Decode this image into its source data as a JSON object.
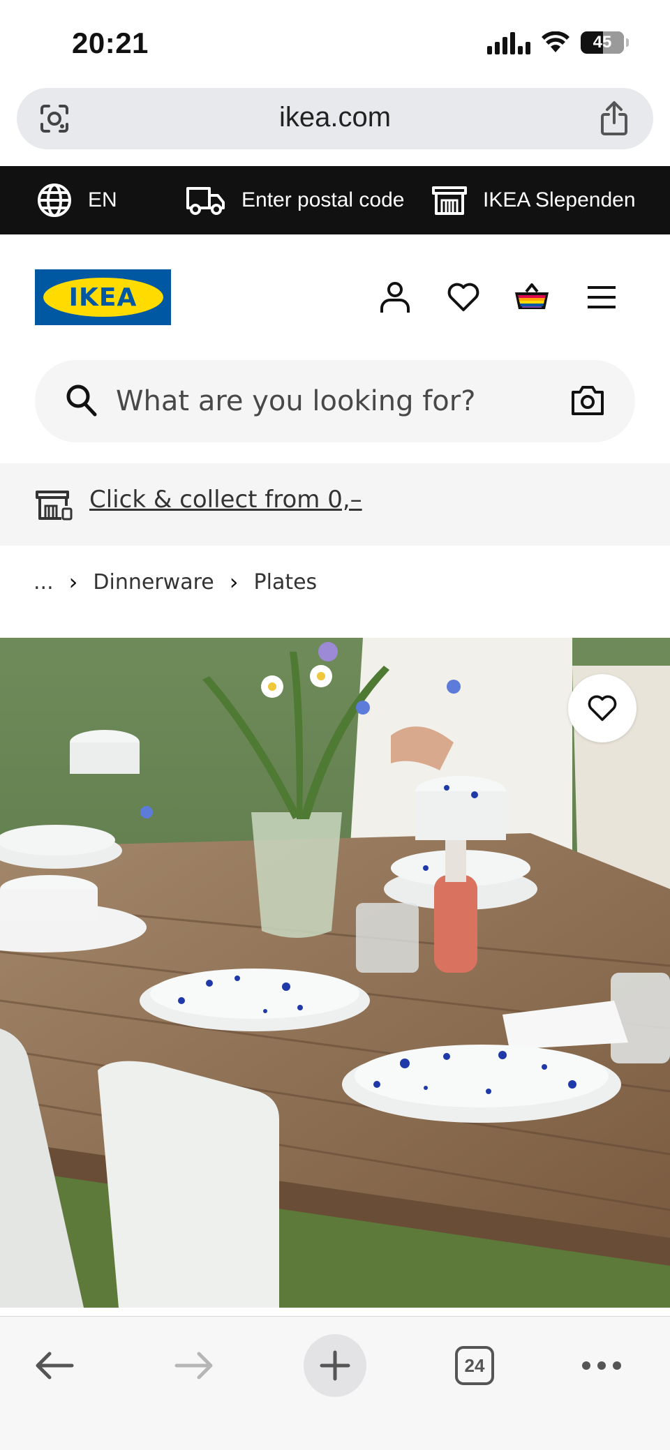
{
  "status_bar": {
    "time": "20:21",
    "battery": "45"
  },
  "browser": {
    "url": "ikea.com",
    "tabs_count": "24"
  },
  "topbar": {
    "language": "EN",
    "postal": "Enter postal code",
    "store": "IKEA Slependen"
  },
  "header": {
    "logo": "IKEA"
  },
  "search": {
    "placeholder": "What are you looking for?"
  },
  "collect": {
    "label": "Click & collect from 0,–"
  },
  "breadcrumb": {
    "ellipsis": "...",
    "items": [
      "Dinnerware",
      "Plates"
    ]
  },
  "colors": {
    "ikea_blue": "#0058a3",
    "ikea_yellow": "#ffdb00",
    "topbar": "#111111"
  },
  "icons": [
    "lens-icon",
    "share-icon",
    "globe-icon",
    "truck-icon",
    "store-icon",
    "user-icon",
    "heart-icon",
    "basket-icon",
    "menu-icon",
    "search-icon",
    "camera-icon",
    "back-icon",
    "forward-icon",
    "plus-icon",
    "more-icon"
  ]
}
